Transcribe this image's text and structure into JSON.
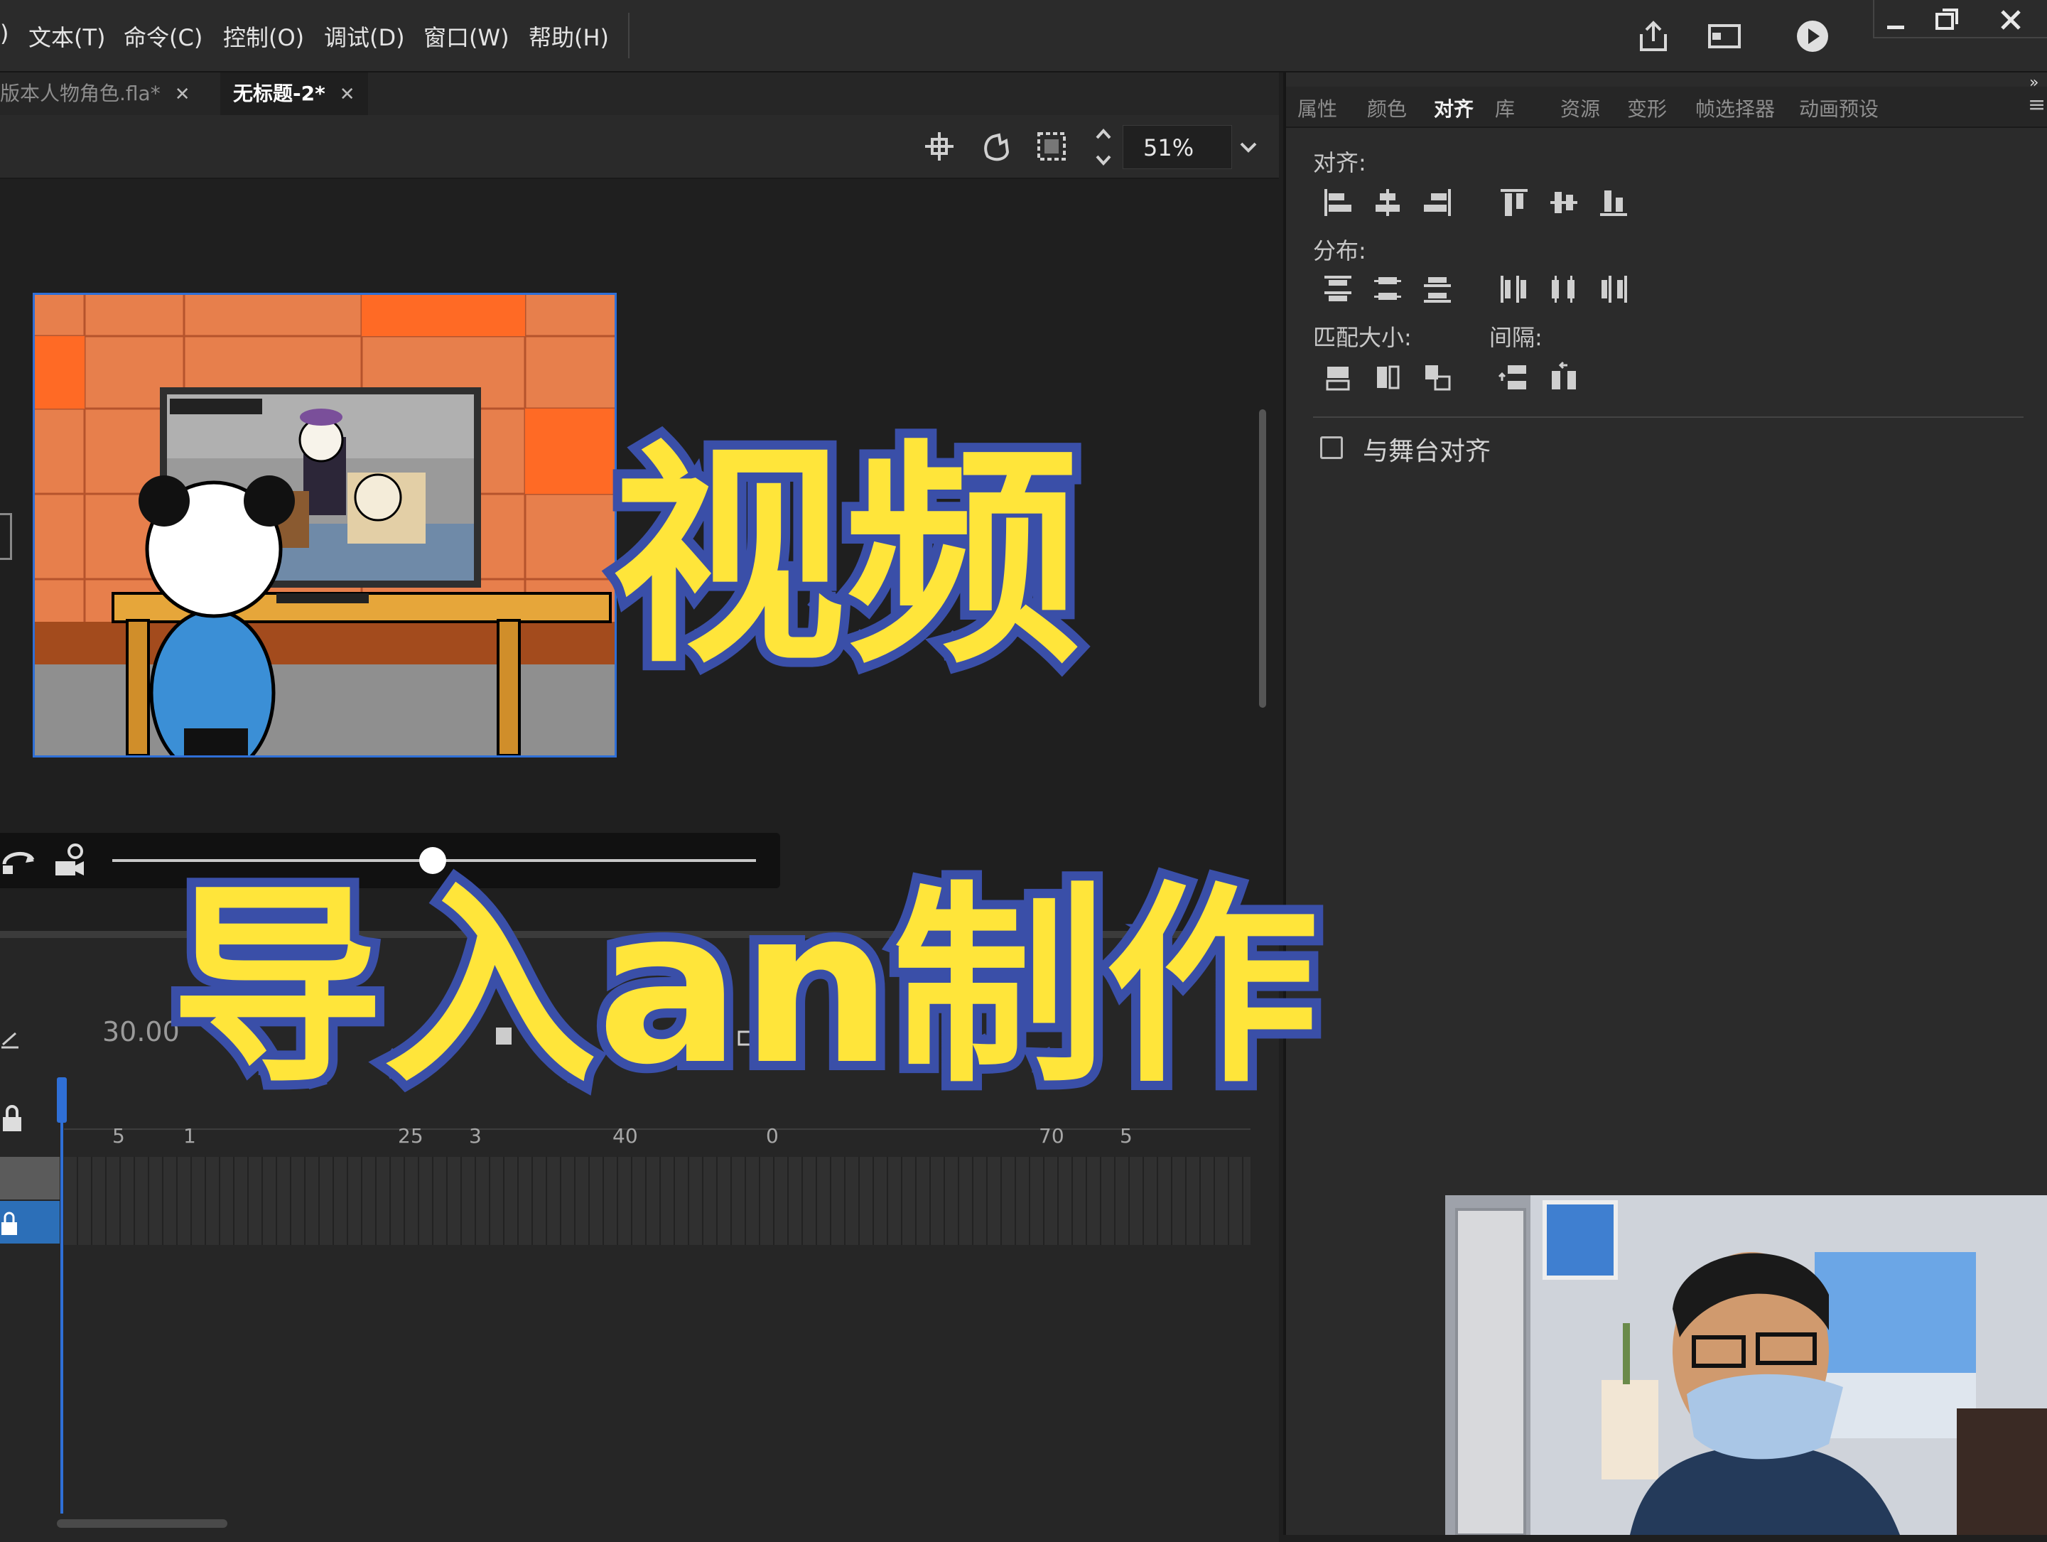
{
  "menu": {
    "items": [
      "文本(T)",
      "命令(C)",
      "控制(O)",
      "调试(D)",
      "窗口(W)",
      "帮助(H)"
    ]
  },
  "tabs": {
    "doc1": "版本人物角色.fla*",
    "doc2": "无标题-2*"
  },
  "stage_toolbar": {
    "zoom": "51%"
  },
  "panel": {
    "tabs": [
      "属性",
      "颜色",
      "对齐",
      "库",
      "资源",
      "变形",
      "帧选择器",
      "动画预设"
    ],
    "active_tab": "对齐",
    "labels": {
      "align": "对齐:",
      "distribute": "分布:",
      "match_size": "匹配大小:",
      "spacing": "间隔:",
      "align_to_stage": "与舞台对齐"
    }
  },
  "timeline": {
    "fps": "30.00",
    "ticks": [
      "5",
      "1",
      "25",
      "3",
      "40",
      "0",
      "70",
      "5"
    ]
  },
  "overlay": {
    "line1": "视频",
    "line2": "导入an制作"
  },
  "colors": {
    "overlay_fill": "#ffe53a",
    "overlay_stroke": "#3a4fa8",
    "stage_border": "#2f6fd6",
    "playhead": "#2f6fd6"
  }
}
